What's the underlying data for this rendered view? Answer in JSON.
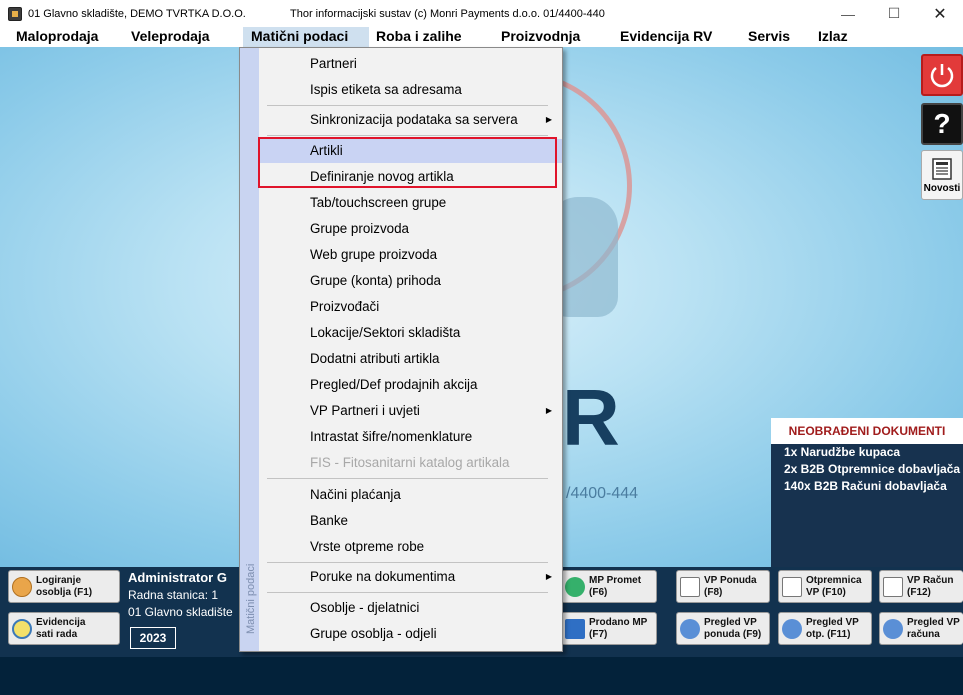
{
  "window": {
    "title_left": "01 Glavno skladište, DEMO TVRTKA D.O.O.",
    "title_center": "Thor informacijski sustav (c) Monri Payments d.o.o. 01/4400-440",
    "minimize": "—",
    "maximize": "☐",
    "close": "✕"
  },
  "menubar": [
    {
      "label": "Maloprodaja"
    },
    {
      "label": "Veleprodaja"
    },
    {
      "label": "Matični podaci"
    },
    {
      "label": "Roba i zalihe"
    },
    {
      "label": "Proizvodnja"
    },
    {
      "label": "Evidencija RV"
    },
    {
      "label": "Servis"
    },
    {
      "label": "Izlaz"
    }
  ],
  "dropdown": {
    "strip_label": "Matični podaci",
    "items": [
      {
        "label": "Partneri"
      },
      {
        "label": "Ispis etiketa sa adresama"
      },
      {
        "label": "Sinkronizacija podataka sa servera",
        "submenu": true
      },
      {
        "label": "Artikli",
        "highlighted": true
      },
      {
        "label": "Definiranje novog artikla"
      },
      {
        "label": "Tab/touchscreen grupe"
      },
      {
        "label": "Grupe proizvoda"
      },
      {
        "label": "Web grupe proizvoda"
      },
      {
        "label": "Grupe (konta) prihoda"
      },
      {
        "label": "Proizvođači"
      },
      {
        "label": "Lokacije/Sektori skladišta"
      },
      {
        "label": "Dodatni atributi artikla"
      },
      {
        "label": "Pregled/Def prodajnih akcija"
      },
      {
        "label": "VP Partneri i uvjeti",
        "submenu": true
      },
      {
        "label": "Intrastat šifre/nomenklature"
      },
      {
        "label": "FIS - Fitosanitarni katalog artikala",
        "disabled": true
      },
      {
        "label": "Načini plaćanja"
      },
      {
        "label": "Banke"
      },
      {
        "label": "Vrste otpreme robe"
      },
      {
        "label": "Poruke na dokumentima",
        "submenu": true
      },
      {
        "label": "Osoblje - djelatnici"
      },
      {
        "label": "Grupe osoblja - odjeli"
      }
    ]
  },
  "background": {
    "letter": "R",
    "phone": "/4400-444"
  },
  "side_buttons": {
    "help": "?",
    "news_label": "Novosti"
  },
  "docs_panel": {
    "title": "NEOBRAĐENI DOKUMENTI",
    "lines": [
      "1x Narudžbe kupaca",
      "2x B2B Otpremnice dobavljača",
      "140x B2B Računi dobavljača"
    ]
  },
  "user": {
    "name": "Administrator G",
    "station": "Radna stanica: 1",
    "warehouse": "01 Glavno skladište",
    "year": "2023"
  },
  "bottom_buttons": {
    "logiranje": "Logiranje\nosoblja (F1)",
    "evidencija": "Evidencija\nsati rada",
    "mp_promet": "MP Promet\n(F6)",
    "prodano_mp": "Prodano MP\n(F7)",
    "vp_ponuda": "VP Ponuda\n(F8)",
    "pregled_vp_ponuda": "Pregled VP\nponuda (F9)",
    "otpremnica": "Otpremnica\nVP (F10)",
    "pregled_vp_otp": "Pregled VP\notp. (F11)",
    "vp_racun": "VP Račun\n(F12)",
    "pregled_vp_racuna": "Pregled VP\nračuna"
  },
  "colors": {
    "menu_highlight": "#c9d3f3",
    "red_outline": "#e0142b",
    "docs_title": "#a01c1c",
    "bottom_bar": "#12324f"
  }
}
